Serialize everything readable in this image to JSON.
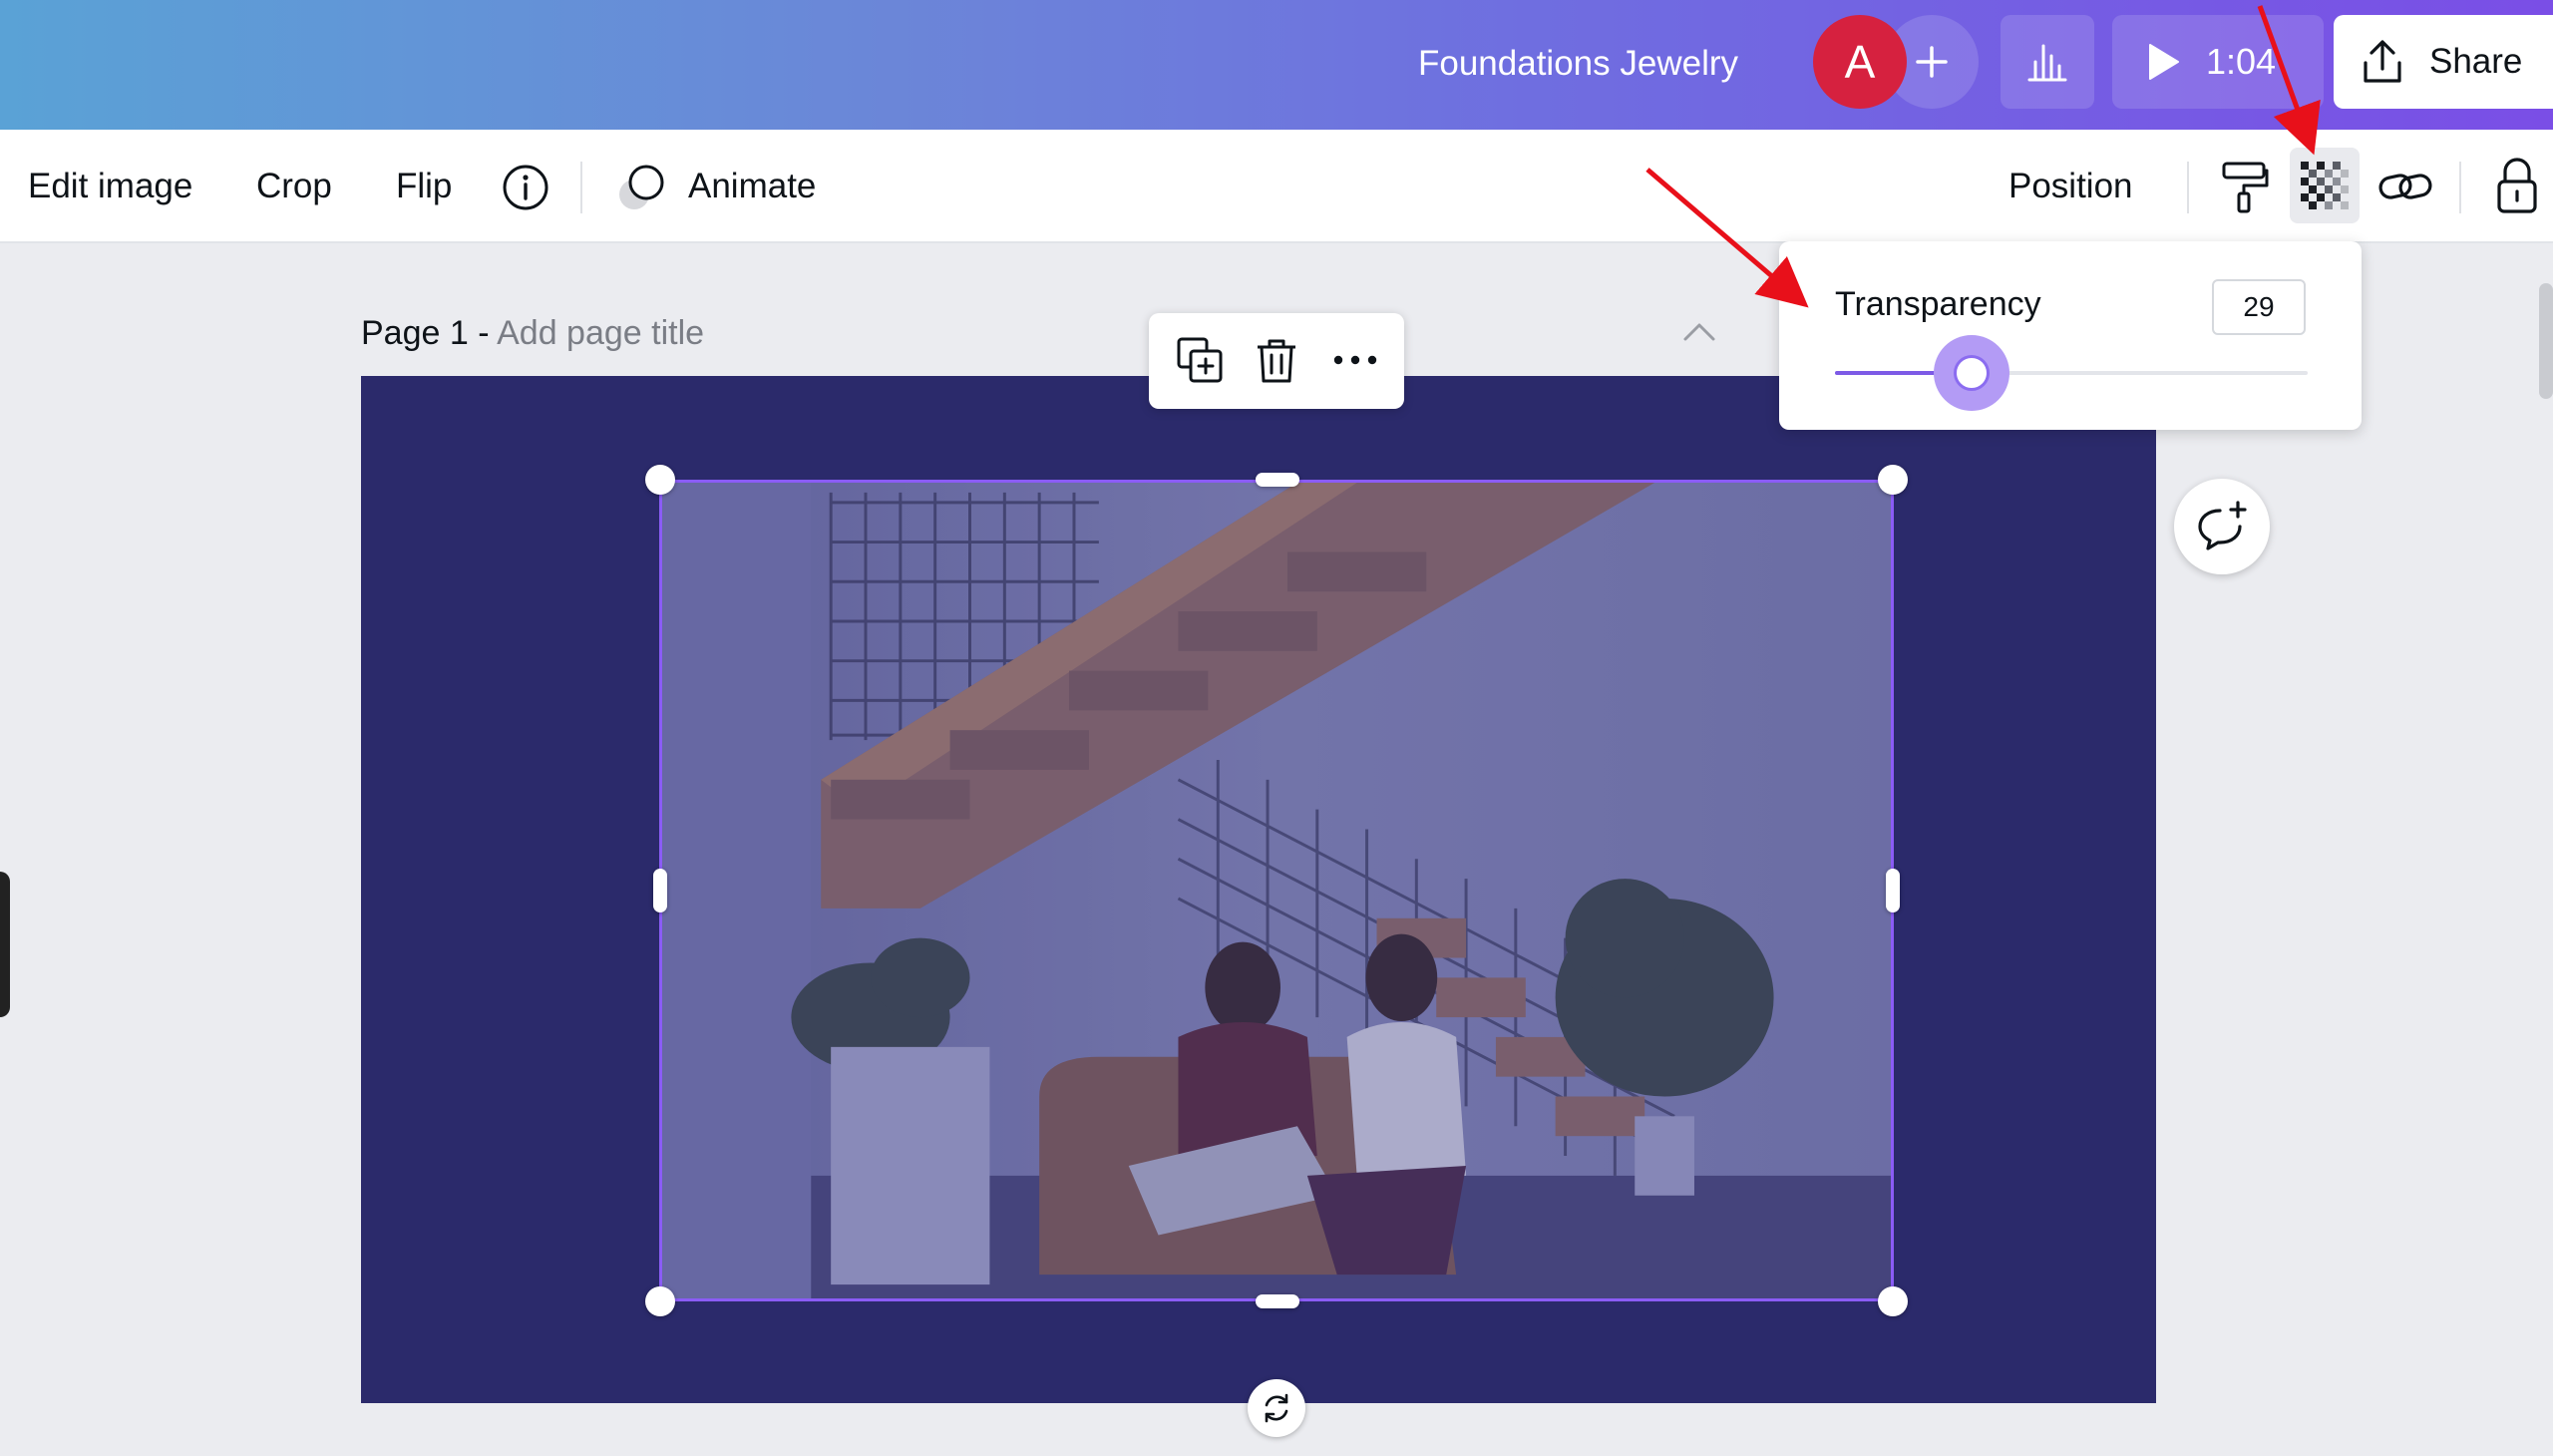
{
  "header": {
    "doc_title": "Foundations Jewelry",
    "avatar_initial": "A",
    "present_time": "1:04",
    "share_label": "Share"
  },
  "toolbar": {
    "edit_image": "Edit image",
    "crop": "Crop",
    "flip": "Flip",
    "animate": "Animate",
    "position": "Position"
  },
  "page": {
    "label": "Page 1 -",
    "title_placeholder": "Add page title",
    "background_color": "#2b2a6b"
  },
  "transparency": {
    "label": "Transparency",
    "value": "29",
    "level_percent": 29
  },
  "colors": {
    "accent": "#7d5ae6",
    "selection": "#8b5cf6",
    "avatar": "#d6213f",
    "arrow": "#e8101a"
  }
}
